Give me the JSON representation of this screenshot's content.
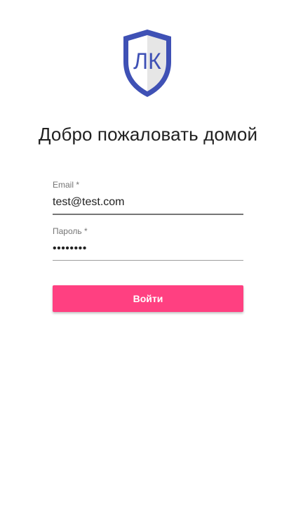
{
  "logo": {
    "text": "ЛК",
    "icon": "shield-icon",
    "shield_color": "#3f51b5",
    "left_fill": "#ffffff",
    "right_fill": "#e6e6e6"
  },
  "page": {
    "title": "Добро пожаловать домой"
  },
  "form": {
    "email": {
      "label": "Email *",
      "value": "test@test.com"
    },
    "password": {
      "label": "Пароль *",
      "value": "12345678"
    },
    "submit_label": "Войти"
  },
  "colors": {
    "accent": "#ff4081",
    "primary": "#3f51b5"
  }
}
